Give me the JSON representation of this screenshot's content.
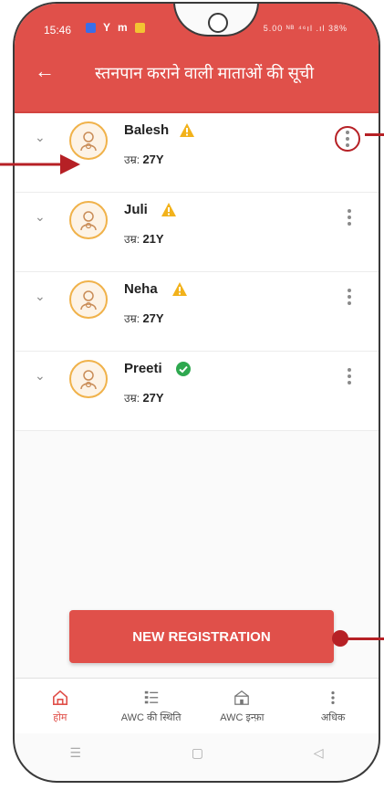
{
  "status_bar": {
    "time": "15:46",
    "icons": [
      "message-icon",
      "yahoo-icon",
      "gmail-icon",
      "app-icon"
    ],
    "right_text": "5.00 ᴺᴮ ⁴⁶ıl .ıl 38%"
  },
  "header": {
    "title": "स्तनपान कराने वाली माताओं की सूची",
    "back_icon": "back-arrow-icon"
  },
  "list": {
    "age_label": "उम्र:",
    "items": [
      {
        "name": "Balesh",
        "age": "27Y",
        "status": "warning",
        "status_icon": "warning-icon"
      },
      {
        "name": "Juli",
        "age": "21Y",
        "status": "warning",
        "status_icon": "warning-icon"
      },
      {
        "name": "Neha",
        "age": "27Y",
        "status": "warning",
        "status_icon": "warning-icon"
      },
      {
        "name": "Preeti",
        "age": "27Y",
        "status": "verified",
        "status_icon": "check-badge-icon"
      }
    ]
  },
  "register_button": "NEW REGISTRATION",
  "bottom_nav": [
    {
      "label": "होम",
      "icon": "home-icon",
      "active": true
    },
    {
      "label": "AWC की स्थिति",
      "icon": "checklist-icon",
      "active": false
    },
    {
      "label": "AWC इन्फ़ा",
      "icon": "building-icon",
      "active": false
    },
    {
      "label": "अधिक",
      "icon": "more-vertical-icon",
      "active": false
    }
  ],
  "colors": {
    "primary": "#e0504a",
    "annotation": "#b62025",
    "warning": "#f2b21b",
    "verified": "#2ea84f"
  }
}
